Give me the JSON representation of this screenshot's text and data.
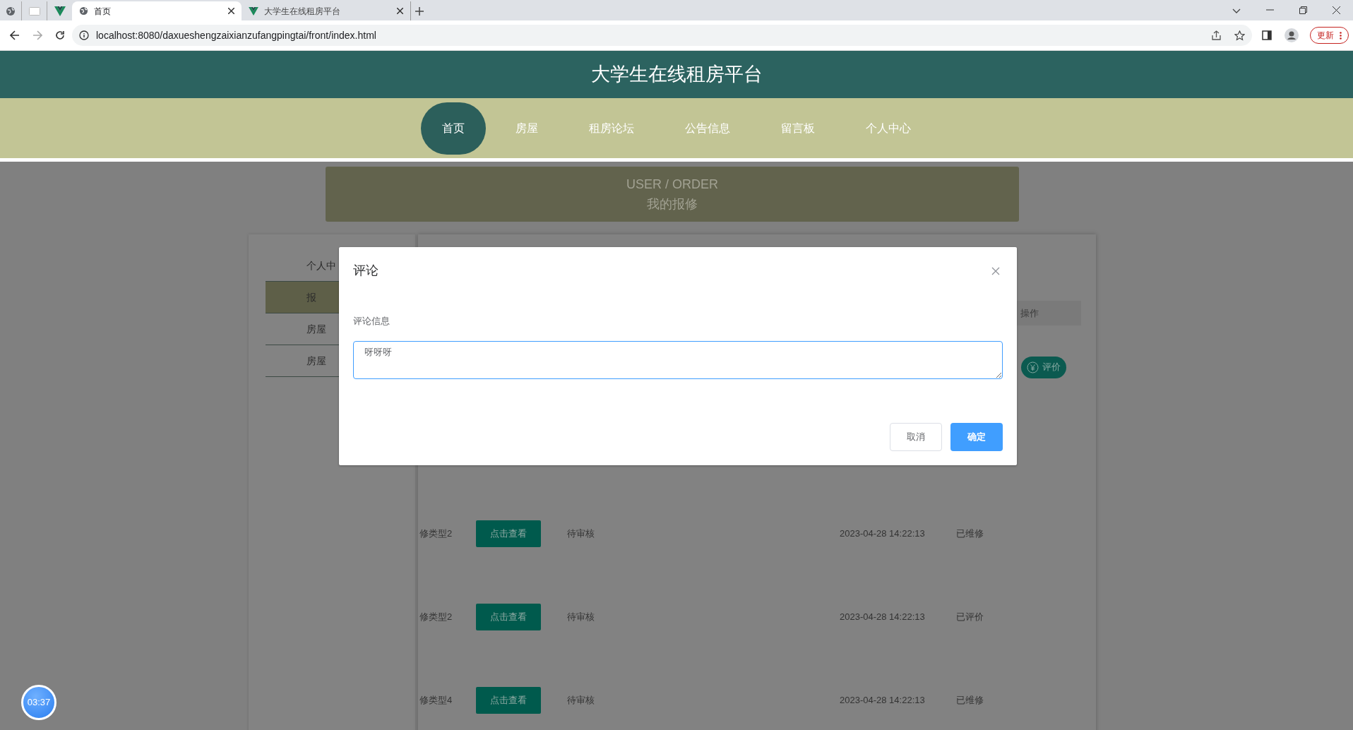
{
  "browser": {
    "tabs": [
      {
        "title": "首页",
        "selected": true
      },
      {
        "title": "大学生在线租房平台",
        "selected": false
      }
    ],
    "url": "localhost:8080/daxueshengzaixianzufangpingtai/front/index.html",
    "update_button": "更新"
  },
  "site_title": "大学生在线租房平台",
  "nav": [
    {
      "label": "首页",
      "selected": true
    },
    {
      "label": "房屋",
      "selected": false
    },
    {
      "label": "租房论坛",
      "selected": false
    },
    {
      "label": "公告信息",
      "selected": false
    },
    {
      "label": "留言板",
      "selected": false
    },
    {
      "label": "个人中心",
      "selected": false
    }
  ],
  "banner": {
    "subtitle": "USER / ORDER",
    "title": "我的报修"
  },
  "sidebar": [
    {
      "label": "个人中",
      "selected": false
    },
    {
      "label": "报",
      "selected": true
    },
    {
      "label": "房屋",
      "selected": false
    },
    {
      "label": "房屋",
      "selected": false
    }
  ],
  "table": {
    "action_header": "操作",
    "rows": [
      {
        "action": "评价"
      },
      {
        "type": "修类型2",
        "detail_button": "点击查看",
        "review": "待审核",
        "date": "2023-04-28 14:22:13",
        "status": "已维修"
      },
      {
        "type": "修类型2",
        "detail_button": "点击查看",
        "review": "待审核",
        "date": "2023-04-28 14:22:13",
        "status": "已评价"
      },
      {
        "type": "修类型4",
        "detail_button": "点击查看",
        "review": "待审核",
        "date": "2023-04-28 14:22:13",
        "status": "已维修"
      }
    ]
  },
  "modal": {
    "title": "评论",
    "field_label": "评论信息",
    "value": "呀呀呀",
    "buttons": [
      {
        "label": "取消",
        "kind": "cancel"
      },
      {
        "label": "确定",
        "kind": "primary"
      }
    ]
  },
  "timer": "03:37"
}
